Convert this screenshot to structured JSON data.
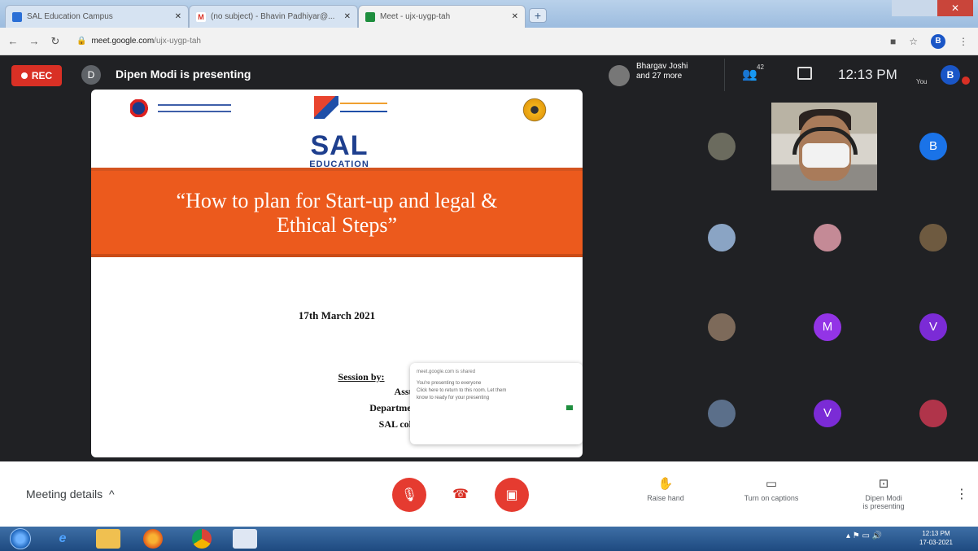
{
  "browser": {
    "tabs": [
      {
        "label": "SAL Education Campus",
        "icon": "sal-favicon",
        "color": "#2a6fd6"
      },
      {
        "label": "(no subject) - Bhavin Padhiyar@...",
        "icon": "gmail-favicon",
        "color": "#d93025"
      },
      {
        "label": "Meet - ujx-uygp-tah",
        "icon": "meet-favicon",
        "color": "#1e8e3e"
      }
    ],
    "new_tab": "+",
    "url_domain": "meet.google.com",
    "url_path": "/ujx-uygp-tah",
    "profile_initial": "B"
  },
  "meet": {
    "rec_label": "REC",
    "presenter_initial": "D",
    "presenting_text": "Dipen Modi is presenting",
    "participants_line1": "Bhargav Joshi",
    "participants_line2": "and 27 more",
    "people_count": "42",
    "time": "12:13 PM",
    "you_label": "You",
    "you_initial": "B"
  },
  "slide": {
    "sal_main": "SAL",
    "sal_sub": "EDUCATION",
    "title_line1": "“How to plan for Start-up and legal &",
    "title_line2": "Ethical Steps”",
    "date": "17th March 2021",
    "session_label": "Session by:",
    "presenter_line": "Asst. Prof. Dipen Modi",
    "department_line": "Department of Mechatronics",
    "college_line": "SAL college of engineering",
    "popup_title": "meet.google.com is shared",
    "popup_line1": "You're presenting to everyone",
    "popup_line2": "Click here to return to this room. Let them",
    "popup_line3": "know to ready for your presenting"
  },
  "grid": {
    "avatars": [
      {
        "initial": "",
        "color": "#6b6b5e"
      },
      {
        "initial": "B",
        "color": "#1a73e8"
      },
      {
        "initial": "",
        "color": "#8aa4c4"
      },
      {
        "initial": "",
        "color": "#c48a96"
      },
      {
        "initial": "",
        "color": "#6e5a40"
      },
      {
        "initial": "",
        "color": "#7d6a5a"
      },
      {
        "initial": "M",
        "color": "#9334e6"
      },
      {
        "initial": "V",
        "color": "#7b2bd6"
      },
      {
        "initial": "",
        "color": "#5b6f8a"
      },
      {
        "initial": "V",
        "color": "#7b2bd6"
      },
      {
        "initial": "",
        "color": "#b0344a"
      }
    ]
  },
  "bottom": {
    "meeting_details": "Meeting details",
    "raise_hand": "Raise hand",
    "captions": "Turn on captions",
    "presenting_line1": "Dipen Modi",
    "presenting_line2": "is presenting"
  },
  "taskbar": {
    "time": "12:13 PM",
    "date": "17-03-2021"
  }
}
